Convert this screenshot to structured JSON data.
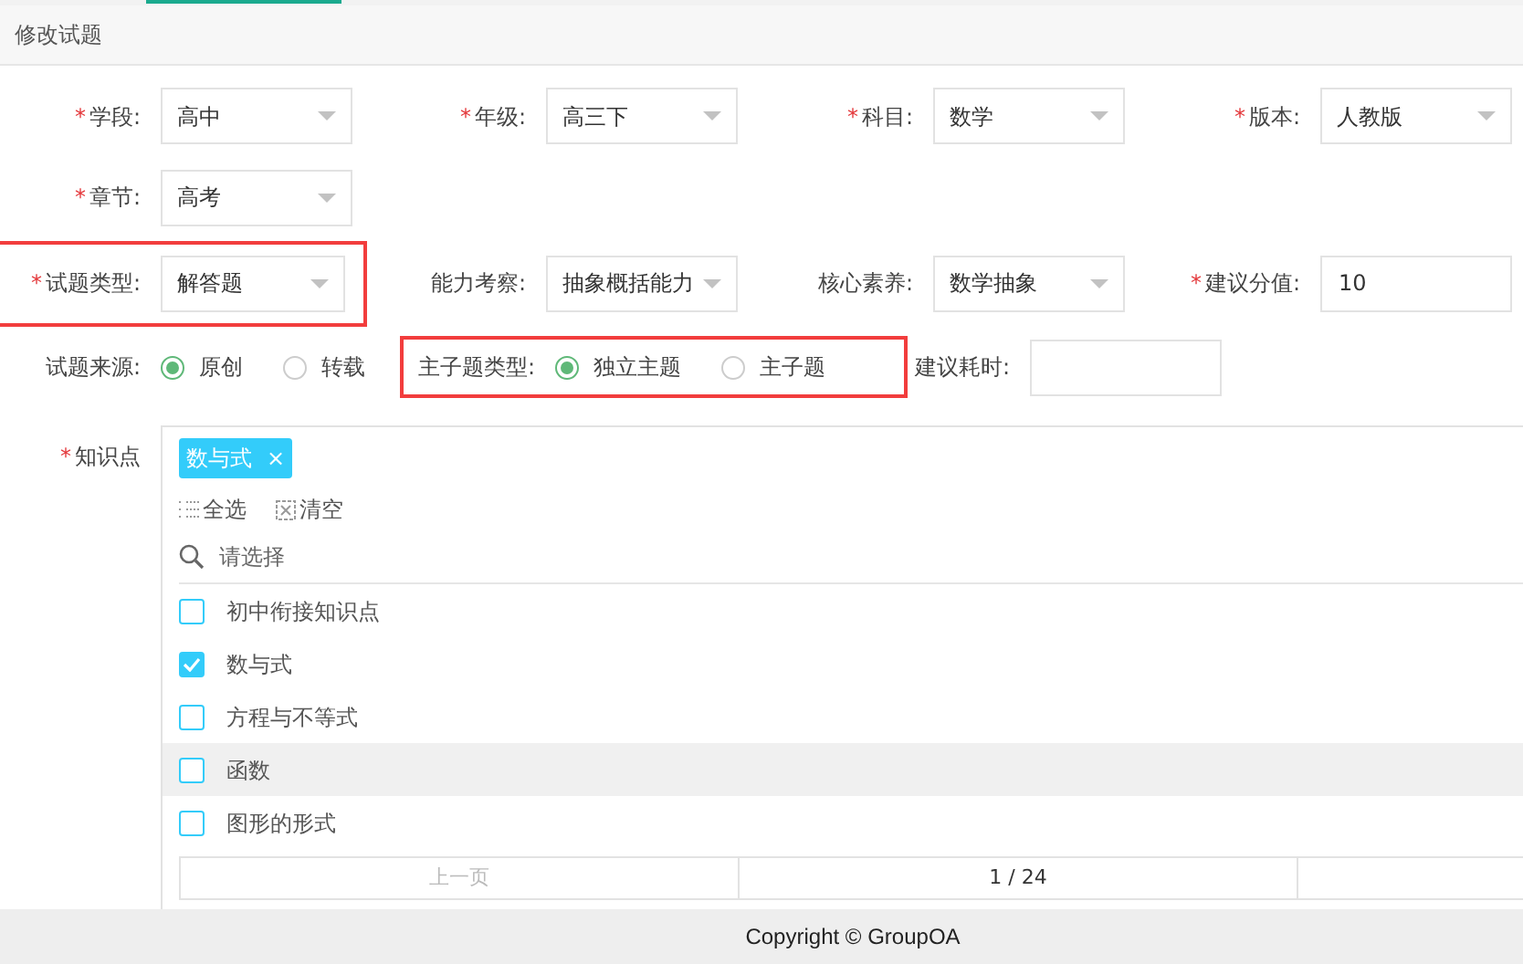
{
  "header": {
    "title": "修改试题"
  },
  "rows": [
    [
      {
        "kind": "select",
        "label": "学段:",
        "required_mark": "*",
        "value": "高中",
        "highlighted": false
      },
      {
        "kind": "select",
        "label": "年级:",
        "required_mark": "*",
        "value": "高三下",
        "highlighted": false
      },
      {
        "kind": "select",
        "label": "科目:",
        "required_mark": "*",
        "value": "数学",
        "highlighted": false
      },
      {
        "kind": "select",
        "label": "版本:",
        "required_mark": "*",
        "value": "人教版",
        "highlighted": false
      }
    ],
    [
      {
        "kind": "select",
        "label": "章节:",
        "required_mark": "*",
        "value": "高考",
        "highlighted": false
      }
    ],
    [
      {
        "kind": "select",
        "label": "试题类型:",
        "required_mark": "*",
        "value": "解答题",
        "highlighted": true
      },
      {
        "kind": "select",
        "label": "能力考察:",
        "value": "抽象概括能力",
        "highlighted": false
      },
      {
        "kind": "select",
        "label": "核心素养:",
        "value": "数学抽象",
        "highlighted": false
      },
      {
        "kind": "input",
        "label": "建议分值:",
        "required_mark": "*",
        "value": "10",
        "highlighted": false
      }
    ],
    [
      {
        "kind": "radio",
        "label": "试题来源:",
        "highlighted": false,
        "options": [
          {
            "label": "原创",
            "selected": true
          },
          {
            "label": "转载",
            "selected": false
          }
        ]
      },
      {
        "kind": "radio",
        "label": "主子题类型:",
        "highlighted": true,
        "options": [
          {
            "label": "独立主题",
            "selected": true
          },
          {
            "label": "主子题",
            "selected": false
          }
        ]
      },
      {
        "kind": "input",
        "label": "建议耗时:",
        "highlighted": false
      }
    ]
  ],
  "knowledge": {
    "label": "知识点",
    "required_mark": "*",
    "tags": [
      {
        "label": "数与式",
        "remove": "×"
      }
    ],
    "toolbar": [
      {
        "label": "全选"
      },
      {
        "label": "清空"
      }
    ],
    "search": {
      "placeholder": "请选择"
    },
    "items": [
      {
        "label": "初中衔接知识点",
        "checked": false,
        "hovered": false
      },
      {
        "label": "数与式",
        "checked": true,
        "hovered": false
      },
      {
        "label": "方程与不等式",
        "checked": false,
        "hovered": false
      },
      {
        "label": "函数",
        "checked": false,
        "hovered": true
      },
      {
        "label": "图形的形式",
        "checked": false,
        "hovered": false
      }
    ],
    "pager": {
      "prev": "上一页",
      "page": "1 / 24"
    }
  },
  "footer": {
    "text": "Copyright © GroupOA"
  }
}
